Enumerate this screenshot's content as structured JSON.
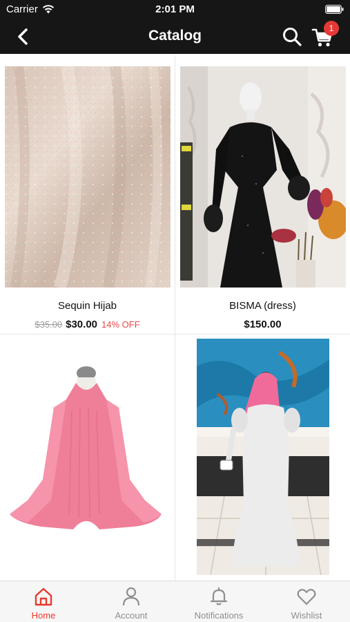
{
  "status_bar": {
    "carrier": "Carrier",
    "time": "2:01 PM"
  },
  "nav": {
    "title": "Catalog",
    "cart_count": "1"
  },
  "products": [
    {
      "name": "Sequin Hijab",
      "old_price": "$35.00",
      "price": "$30.00",
      "discount": "14% OFF"
    },
    {
      "name": "BISMA (dress)",
      "price": "$150.00"
    },
    {
      "name": "",
      "price": ""
    },
    {
      "name": "",
      "price": ""
    }
  ],
  "tabs": [
    {
      "label": "Home",
      "icon": "home-icon",
      "active": true
    },
    {
      "label": "Account",
      "icon": "account-icon",
      "active": false
    },
    {
      "label": "Notifications",
      "icon": "bell-icon",
      "active": false
    },
    {
      "label": "Wishlist",
      "icon": "heart-icon",
      "active": false
    }
  ],
  "colors": {
    "bar_background": "#161616",
    "accent": "#e8392e",
    "badge": "#e53935",
    "discount": "#e8474a"
  }
}
